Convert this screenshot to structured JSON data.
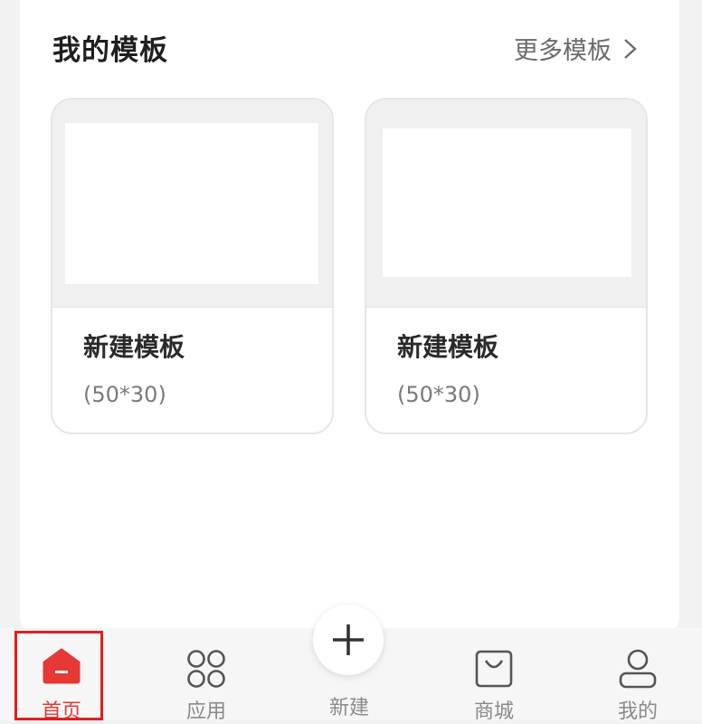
{
  "section": {
    "title": "我的模板",
    "more_label": "更多模板"
  },
  "templates": [
    {
      "name": "新建模板",
      "size": "(50*30)"
    },
    {
      "name": "新建模板",
      "size": "(50*30)"
    }
  ],
  "tabs": {
    "home": "首页",
    "apps": "应用",
    "new": "新建",
    "mall": "商城",
    "mine": "我的"
  },
  "colors": {
    "accent": "#e53935",
    "highlight_border": "#e01f1f"
  },
  "icons": {
    "home": "home-icon",
    "apps": "apps-grid-icon",
    "new": "plus-icon",
    "mall": "shopping-bag-icon",
    "mine": "user-icon",
    "more": "chevron-right-icon"
  }
}
